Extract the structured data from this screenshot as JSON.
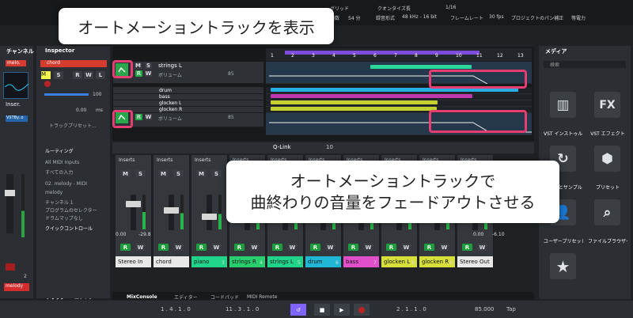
{
  "top": {
    "quantize": "グリッド",
    "quantize_mode": "クオンタイズ長",
    "grid": "1/16",
    "bars": "拍数",
    "bars_value": "54 分",
    "rec": "録音形式",
    "rec_value": "48 kHz - 16 bit",
    "frame": "フレームレート",
    "frame_value": "30 fps",
    "pan": "プロジェクトのパン補正",
    "pan_value": "等電力"
  },
  "left": {
    "title": "チャンネル",
    "track": "melo.",
    "insert": "Inser.",
    "vst": "VSTBy..o",
    "bottom": "melody",
    "count": "2",
    "tab": "トラック",
    "editor": "エディター"
  },
  "inspector": {
    "title": "Inspector",
    "chord": "chord",
    "value1": "100",
    "value2": "0.00",
    "unit": "ms",
    "preset": "トラックプリセット...",
    "routing": "ルーティング",
    "midi": "All MIDI Inputs",
    "inputs": "すべての入力",
    "out": "02. melody - MIDI",
    "melody": "melody",
    "channel": "チャンネル 1",
    "program": "プログラムのセレクター",
    "drum": "ドラムマップなし",
    "quick": "クイックコントロール"
  },
  "tracks": [
    {
      "name": "strings L",
      "type": "audio"
    },
    {
      "name": "drum",
      "type": "audio"
    },
    {
      "name": "bass",
      "type": "audio"
    },
    {
      "name": "glocken L",
      "type": "audio"
    },
    {
      "name": "glocken R",
      "type": "audio"
    }
  ],
  "automation": {
    "label": "ボリューム",
    "value": "85"
  },
  "ruler": {
    "bars": [
      "1",
      "2",
      "3",
      "4",
      "5",
      "6",
      "7",
      "8",
      "9",
      "10",
      "11",
      "12",
      "13"
    ]
  },
  "mix": {
    "qlink": "Q-Link",
    "count": "10",
    "inserts": "Inserts"
  },
  "channels": [
    {
      "name": "Stereo In",
      "color": "#e8e8e8"
    },
    {
      "name": "chord",
      "color": "#e8e8e8"
    },
    {
      "name": "piano",
      "color": "#20d58a"
    },
    {
      "name": "strings R",
      "color": "#28cf6e"
    },
    {
      "name": "strings L",
      "color": "#20d58a"
    },
    {
      "name": "drum",
      "color": "#20b6d5"
    },
    {
      "name": "bass",
      "color": "#e14fcb"
    },
    {
      "name": "glocken L",
      "color": "#d7df3a"
    },
    {
      "name": "glocken R",
      "color": "#d7df3a"
    },
    {
      "name": "Stereo Out",
      "color": "#e8e8e8"
    }
  ],
  "numbers": {
    "n1": "1",
    "n2": "2",
    "n3": "3",
    "n4": "4",
    "n5": "5",
    "n6": "6",
    "n7": "7",
    "n8": "8",
    "n9": "9",
    "n10": "10",
    "n11": "11",
    "n12": "12"
  },
  "levels": {
    "left": "0.00",
    "right": "-29.8",
    "out": "0.00",
    "out2": "-6.10"
  },
  "media": {
    "title": "メディア",
    "search": "検索",
    "items": [
      {
        "label": "VST インストゥルメント",
        "icon": "piano-icon"
      },
      {
        "label": "VST エフェクト",
        "icon": "fx-icon"
      },
      {
        "label": "ループとサンプル",
        "icon": "loop-icon"
      },
      {
        "label": "プリセット",
        "icon": "preset-icon"
      },
      {
        "label": "ユーザープリセット",
        "icon": "user-preset-icon"
      },
      {
        "label": "ファイルブラウザー",
        "icon": "file-browser-icon"
      }
    ]
  },
  "bottom": {
    "mix": "MixConsole",
    "editor": "エディター",
    "pad": "コードパッド",
    "remote": "MIDI Remote",
    "position": "1 . 4 . 1 . 0",
    "end": "11 . 3 . 1 . 0",
    "locator": "2 . 1 . 1 . 0",
    "tempo": "85.000",
    "tap": "Tap"
  },
  "callouts": {
    "top": "オートメーショントラックを表示",
    "bottom_line1": "オートメーショントラックで",
    "bottom_line2": "曲終わりの音量をフェードアウトさせる"
  }
}
